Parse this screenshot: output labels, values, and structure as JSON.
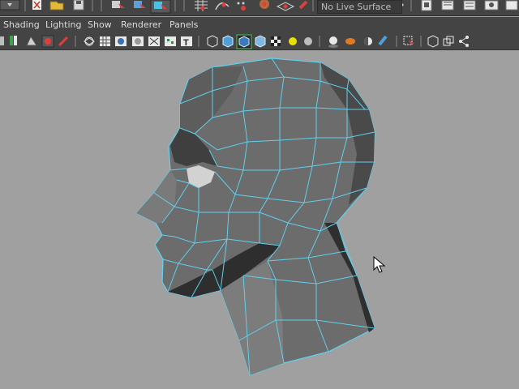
{
  "app": {
    "accent": "#5fd0ee",
    "viewport_bg": "#a0a0a0",
    "ui_bg": "#444444"
  },
  "status_line": {
    "live_surface_label": "No Live Surface",
    "icons": [
      "dropdown-icon",
      "new-scene-icon",
      "open-scene-icon",
      "save-scene-icon",
      "select-hierarchy-icon",
      "select-object-icon",
      "select-component-icon",
      "snap-grid-icon",
      "snap-curve-icon",
      "snap-point-icon",
      "snap-view-plane-icon",
      "make-live-icon",
      "render-icon",
      "ipr-render-icon",
      "render-settings-icon"
    ]
  },
  "panel_menu": {
    "items": [
      "Shading",
      "Lighting",
      "Show",
      "Renderer",
      "Panels"
    ]
  },
  "panel_toolbar": {
    "icons": [
      "select-camera-icon",
      "bookmark-icon",
      "image-plane-icon",
      "camera-attributes-icon",
      "wireframe-icon",
      "grid-icon",
      "smooth-shade-icon",
      "flat-shade-icon",
      "xray-icon",
      "texture-icon",
      "text-icon",
      "wireframe-cube-icon",
      "shaded-cube-icon",
      "isolate-select-icon",
      "bounding-box-icon",
      "checker-icon",
      "lights-icon",
      "shadows-icon",
      "material-sphere-icon",
      "ambient-occlusion-icon",
      "half-sphere-icon",
      "motion-blur-icon",
      "select-tool-icon",
      "frame-icon",
      "show-all-icon",
      "share-icon"
    ]
  },
  "viewport": {
    "model": "head-mesh",
    "wireframe_color": "#5fd0ee"
  }
}
